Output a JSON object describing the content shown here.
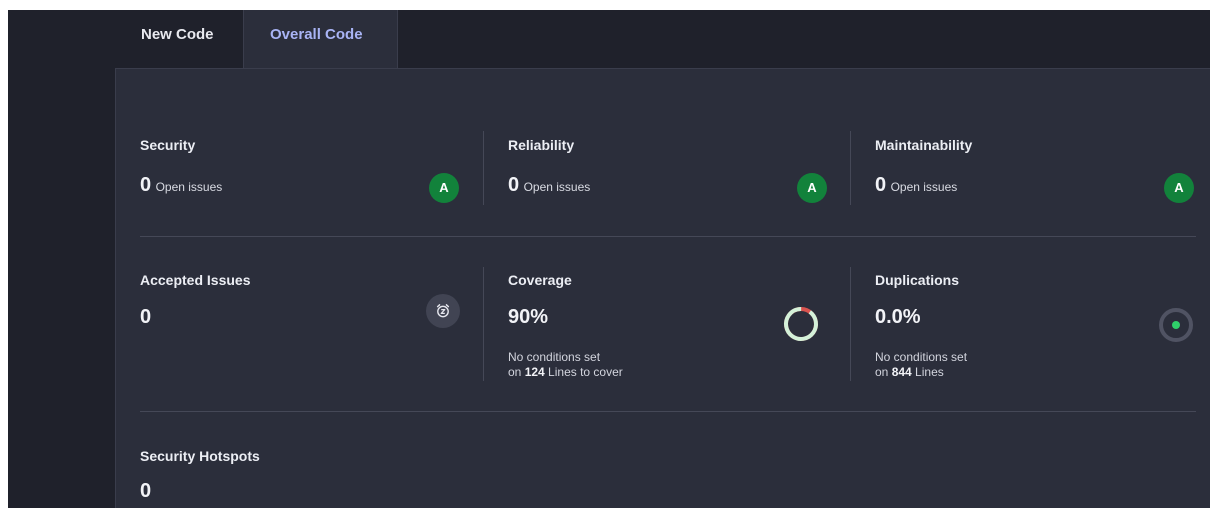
{
  "tabs": [
    {
      "label": "New Code"
    },
    {
      "label": "Overall Code"
    }
  ],
  "metrics": {
    "security": {
      "title": "Security",
      "value": "0",
      "suffix": "Open issues",
      "grade": "A"
    },
    "reliability": {
      "title": "Reliability",
      "value": "0",
      "suffix": "Open issues",
      "grade": "A"
    },
    "maintainability": {
      "title": "Maintainability",
      "value": "0",
      "suffix": "Open issues",
      "grade": "A"
    },
    "accepted": {
      "title": "Accepted Issues",
      "value": "0"
    },
    "coverage": {
      "title": "Coverage",
      "value": "90%",
      "line1": "No conditions set",
      "line2_prefix": "on ",
      "line2_count": "124",
      "line2_suffix": " Lines to cover",
      "percent": 90
    },
    "duplications": {
      "title": "Duplications",
      "value": "0.0%",
      "line1": "No conditions set",
      "line2_prefix": "on ",
      "line2_count": "844",
      "line2_suffix": " Lines"
    },
    "hotspots": {
      "title": "Security Hotspots",
      "value": "0"
    }
  },
  "colors": {
    "grade_a": "#12823b",
    "coverage_good": "#d4f1d9",
    "coverage_bad": "#d9534f",
    "dup_dot": "#2fcf6a",
    "active_tab": "#a9b4f5"
  },
  "icons": {
    "accepted": "alarm-clock-icon",
    "coverage": "coverage-ring-icon",
    "duplications": "duplication-dot-icon"
  }
}
